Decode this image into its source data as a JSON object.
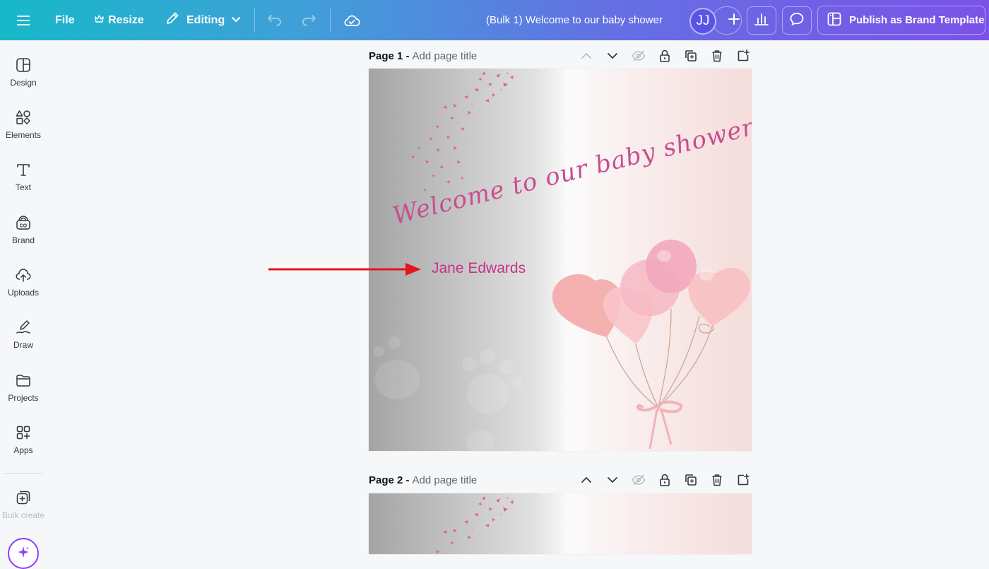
{
  "topbar": {
    "menu_icon": "hamburger-icon",
    "file_label": "File",
    "resize_label": "Resize",
    "editing_label": "Editing",
    "doc_title": "(Bulk 1) Welcome to our baby shower",
    "avatar_initials": "JJ",
    "publish_label": "Publish as Brand Template"
  },
  "sidebar": {
    "items": [
      {
        "label": "Design",
        "icon": "design-icon"
      },
      {
        "label": "Elements",
        "icon": "elements-icon"
      },
      {
        "label": "Text",
        "icon": "text-icon"
      },
      {
        "label": "Brand",
        "icon": "brand-icon"
      },
      {
        "label": "Uploads",
        "icon": "uploads-icon"
      },
      {
        "label": "Draw",
        "icon": "draw-icon"
      },
      {
        "label": "Projects",
        "icon": "projects-icon"
      },
      {
        "label": "Apps",
        "icon": "apps-icon"
      },
      {
        "label": "Bulk create",
        "icon": "bulk-create-icon"
      }
    ]
  },
  "pages": [
    {
      "label": "Page 1 -",
      "title_placeholder": "Add page title"
    },
    {
      "label": "Page 2 -",
      "title_placeholder": "Add page title"
    }
  ],
  "design": {
    "heading": "Welcome to our baby shower",
    "name": "Jane Edwards"
  },
  "colors": {
    "accent_pink": "#c5338a",
    "arrow_red": "#e8141c",
    "purple": "#8b3dff"
  }
}
